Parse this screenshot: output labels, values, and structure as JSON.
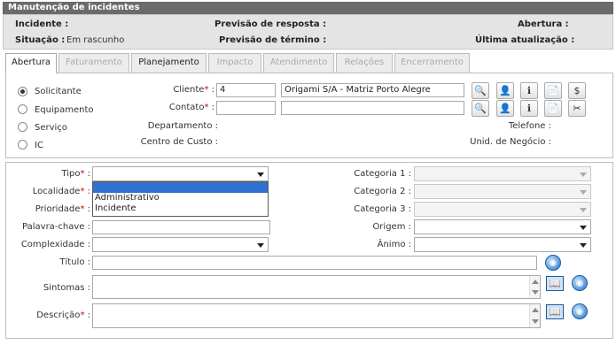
{
  "title": "Manutenção de incidentes",
  "info": {
    "incidente_label": "Incidente :",
    "previsao_resposta_label": "Previsão de resposta :",
    "previsao_resposta_value": "-",
    "abertura_label": "Abertura :",
    "situacao_label": "Situação :",
    "situacao_value": "Em rascunho",
    "previsao_termino_label": "Previsão de término :",
    "previsao_termino_value": "-",
    "ultima_atualizacao_label": "Última atualização :"
  },
  "tabs": [
    {
      "label": "Abertura",
      "state": "active"
    },
    {
      "label": "Faturamento",
      "state": "disabled"
    },
    {
      "label": "Planejamento",
      "state": "enabled"
    },
    {
      "label": "Impacto",
      "state": "disabled"
    },
    {
      "label": "Atendimento",
      "state": "disabled"
    },
    {
      "label": "Relações",
      "state": "disabled"
    },
    {
      "label": "Encerramento",
      "state": "disabled"
    }
  ],
  "requester": {
    "options": [
      "Solicitante",
      "Equipamento",
      "Serviço",
      "IC"
    ],
    "selected": "Solicitante",
    "cliente_label": "Cliente",
    "cliente_code": "4",
    "cliente_name": "Origami S/A - Matriz Porto Alegre",
    "contato_label": "Contato",
    "contato_code": "",
    "contato_name": "",
    "departamento_label": "Departamento :",
    "centro_custo_label": "Centro de Custo :",
    "telefone_label": "Telefone :",
    "unid_negocio_label": "Unid. de Negócio :"
  },
  "form": {
    "tipo_label": "Tipo",
    "tipo_options": [
      "",
      "Administrativo",
      "Incidente"
    ],
    "localidade_label": "Localidade",
    "prioridade_label": "Prioridade",
    "palavra_chave_label": "Palavra-chave :",
    "complexidade_label": "Complexidade :",
    "titulo_label": "Título :",
    "sintomas_label": "Sintomas :",
    "descricao_label": "Descrição",
    "categoria1_label": "Categoria 1 :",
    "categoria2_label": "Categoria 2 :",
    "categoria3_label": "Categoria 3 :",
    "origem_label": "Origem :",
    "animo_label": "Ânimo :"
  },
  "colors": {
    "titlebar": "#6b6b6b",
    "info_bg": "#e4e4e4",
    "selected_option": "#3070d0",
    "required": "#cc0000"
  }
}
